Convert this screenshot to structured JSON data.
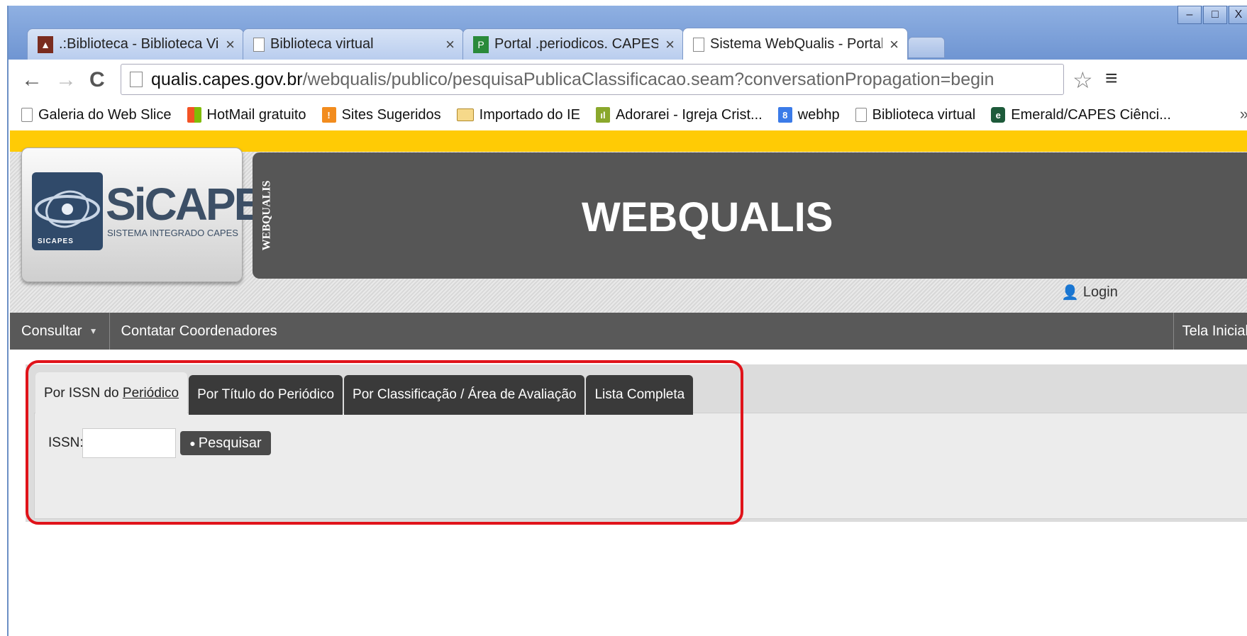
{
  "browser": {
    "tabs": [
      {
        "label": ".:Biblioteca - Biblioteca Virtual",
        "close": "×",
        "icon": "site-icon"
      },
      {
        "label": "Biblioteca virtual",
        "close": "×",
        "icon": "page-icon"
      },
      {
        "label": "Portal .periodicos. CAPES",
        "close": "×",
        "icon": "portal-icon"
      },
      {
        "label": "Sistema WebQualis - Portal C",
        "close": "×",
        "icon": "page-icon"
      }
    ],
    "window_buttons": {
      "minimize": "–",
      "maximize": "□",
      "close": "X"
    },
    "nav": {
      "back": "←",
      "forward": "→",
      "reload": "C"
    },
    "url_host": "qualis.capes.gov.br",
    "url_path": "/webqualis/publico/pesquisaPublicaClassificacao.seam?conversationPropagation=begin",
    "star": "☆",
    "menu": "≡",
    "bookmarks": [
      {
        "label": "Galeria do Web Slice",
        "icon": "page-icon",
        "color": "#ffffff"
      },
      {
        "label": "HotMail gratuito",
        "icon": "windows-icon",
        "color": "#f35325"
      },
      {
        "label": "Sites Sugeridos",
        "icon": "bulb-icon",
        "color": "#f28c1e"
      },
      {
        "label": "Importado do IE",
        "icon": "folder-icon",
        "color": "#e9c36b"
      },
      {
        "label": "Adorarei - Igreja Crist...",
        "icon": "chart-icon",
        "color": "#8aa82c"
      },
      {
        "label": "webhp",
        "icon": "google-icon",
        "color": "#3b7be8"
      },
      {
        "label": "Biblioteca virtual",
        "icon": "page-icon",
        "color": "#ffffff"
      },
      {
        "label": "Emerald/CAPES Ciênci...",
        "icon": "emerald-icon",
        "color": "#1d5a3a"
      }
    ],
    "more": "»"
  },
  "site": {
    "logo_text": "SiCAPES",
    "logo_sub": "SISTEMA INTEGRADO CAPES",
    "logo_small": "SICAPES",
    "banner_side": "WEBQUALIS",
    "banner_title": "WEBQUALIS",
    "login": "Login",
    "menu": {
      "consultar": "Consultar",
      "contatar": "Contatar Coordenadores",
      "right": "Tela Inicial"
    }
  },
  "search": {
    "tabs": [
      {
        "label_prefix": "Por ISSN do ",
        "label_underlined": "Periódico"
      },
      {
        "label": "Por Título do Periódico"
      },
      {
        "label": "Por Classificação / Área de Avaliação"
      },
      {
        "label": "Lista Completa"
      }
    ],
    "issn_label": "ISSN:",
    "issn_value": "",
    "button": "Pesquisar"
  },
  "colors": {
    "accent_yellow": "#ffcb05",
    "highlight_red": "#e0131a",
    "banner_gray": "#565656"
  }
}
